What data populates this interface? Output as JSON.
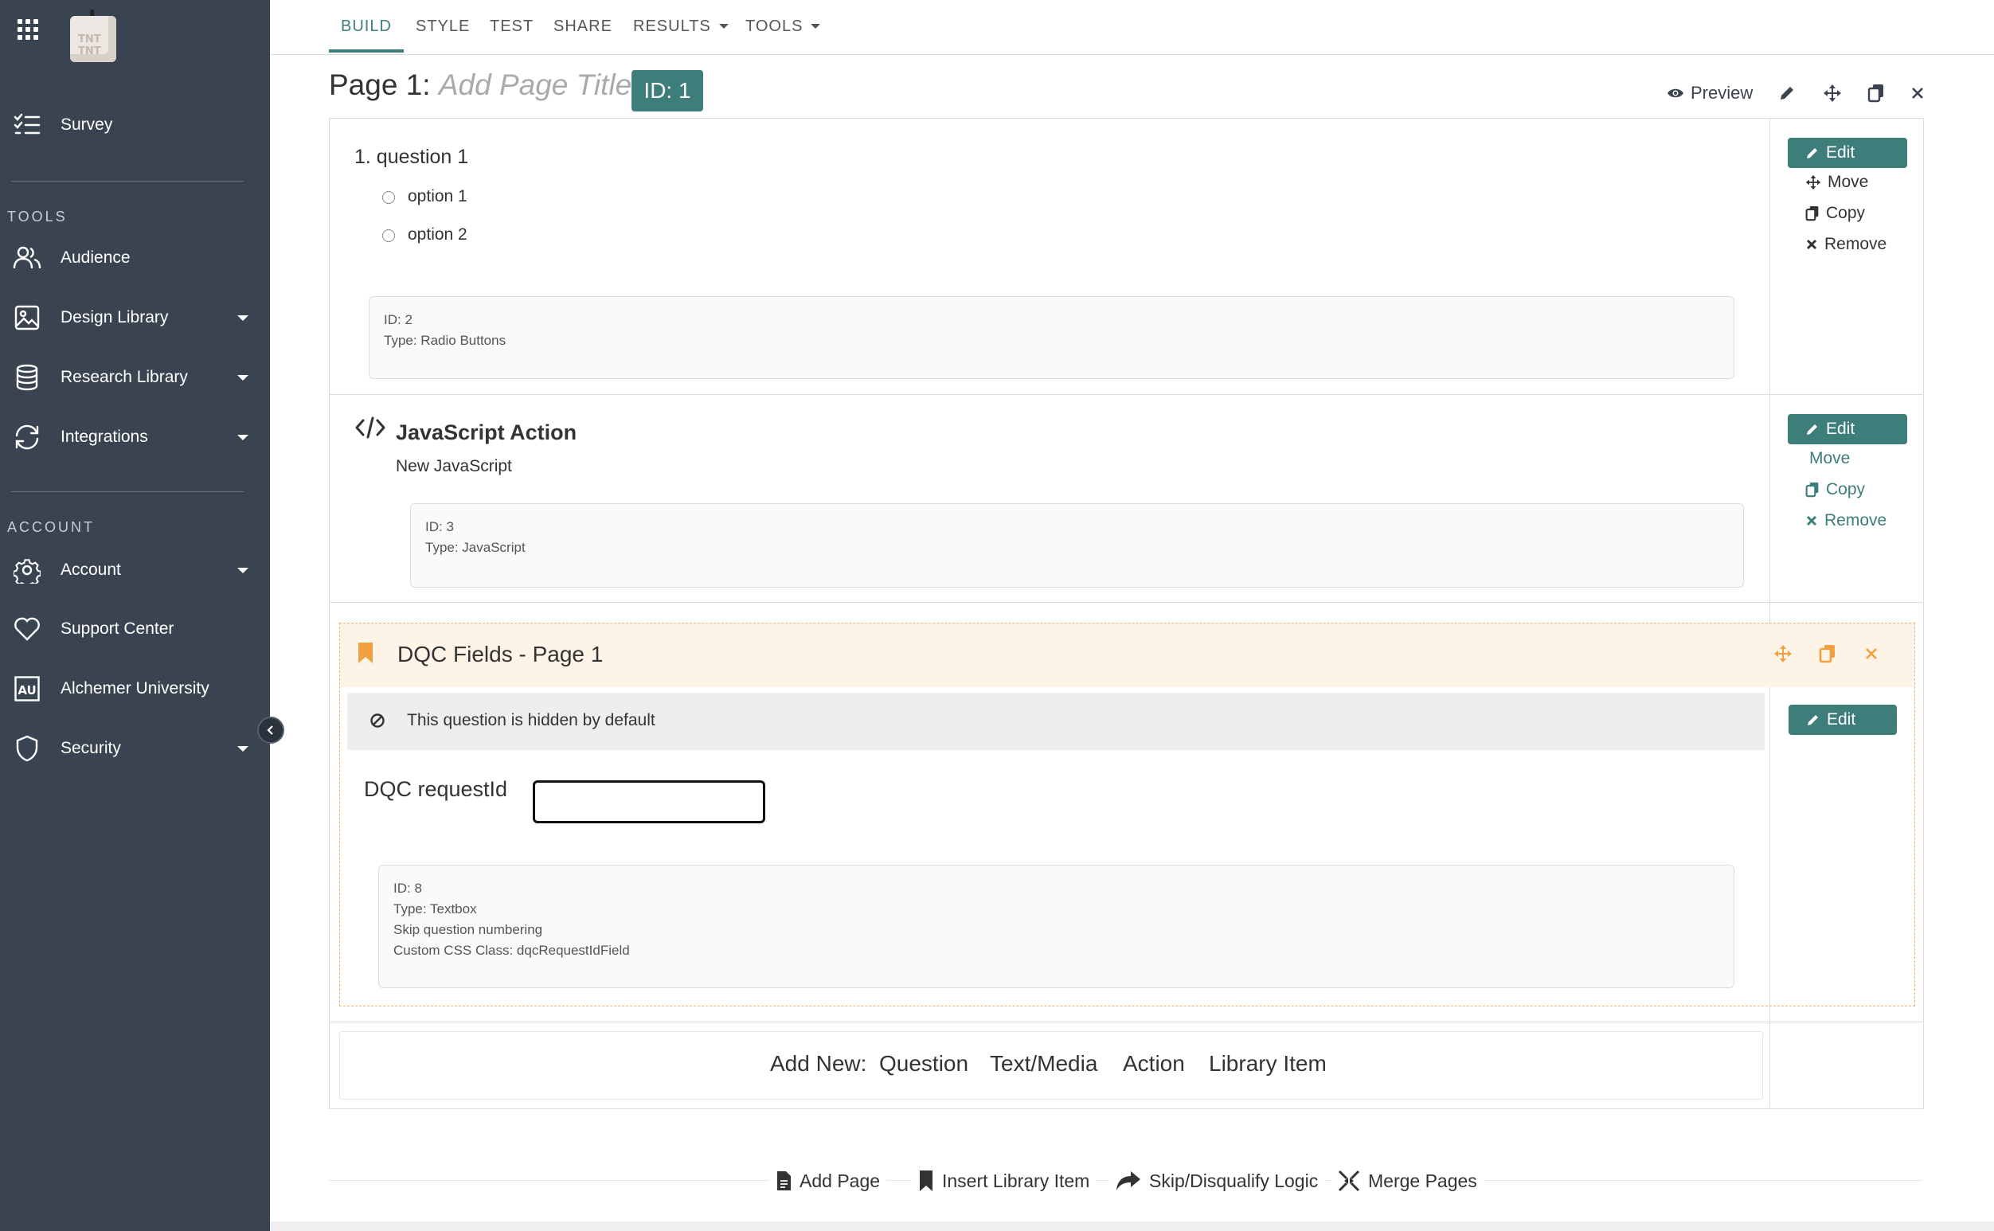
{
  "sidebar": {
    "survey_label": "Survey",
    "tools_heading": "TOOLS",
    "account_heading": "ACCOUNT",
    "items": [
      {
        "label": "Audience"
      },
      {
        "label": "Design Library"
      },
      {
        "label": "Research Library"
      },
      {
        "label": "Integrations"
      },
      {
        "label": "Account"
      },
      {
        "label": "Support Center"
      },
      {
        "label": "Alchemer University"
      },
      {
        "label": "Security"
      }
    ],
    "logo_text": "TNT TNT",
    "university_icon_text": "AU"
  },
  "tabs": [
    {
      "label": "BUILD",
      "active": true
    },
    {
      "label": "STYLE"
    },
    {
      "label": "TEST"
    },
    {
      "label": "SHARE"
    },
    {
      "label": "RESULTS"
    },
    {
      "label": "TOOLS"
    }
  ],
  "page": {
    "title_prefix": "Page 1:",
    "title_placeholder": "Add Page Title",
    "id_badge": "ID: 1",
    "preview_label": "Preview"
  },
  "questions": [
    {
      "title": "1. question 1",
      "options": [
        "option 1",
        "option 2"
      ],
      "info": [
        "ID: 2",
        "Type: Radio Buttons"
      ]
    }
  ],
  "actions": {
    "edit": "Edit",
    "move": "Move",
    "copy": "Copy",
    "remove": "Remove"
  },
  "javascript_action": {
    "title": "JavaScript Action",
    "subtitle": "New JavaScript",
    "info": [
      "ID: 3",
      "Type: JavaScript"
    ]
  },
  "dqc": {
    "title": "DQC Fields - Page 1",
    "hidden_notice": "This question is hidden by default",
    "field_label": "DQC requestId",
    "field_value": "",
    "info": [
      "ID: 8",
      "Type: Textbox",
      "Skip question numbering",
      "Custom CSS Class: dqcRequestIdField"
    ]
  },
  "add_new": {
    "label": "Add New:",
    "options": [
      "Question",
      "Text/Media",
      "Action",
      "Library Item"
    ]
  },
  "footer": {
    "add_page": "Add Page",
    "insert_library_item": "Insert Library Item",
    "skip_logic": "Skip/Disqualify Logic",
    "merge_pages": "Merge Pages"
  },
  "colors": {
    "sidebar_bg": "#3a4350",
    "accent": "#3d7e7a",
    "dqc_orange": "#f0a040",
    "dqc_header_bg": "#fdf3e6"
  }
}
